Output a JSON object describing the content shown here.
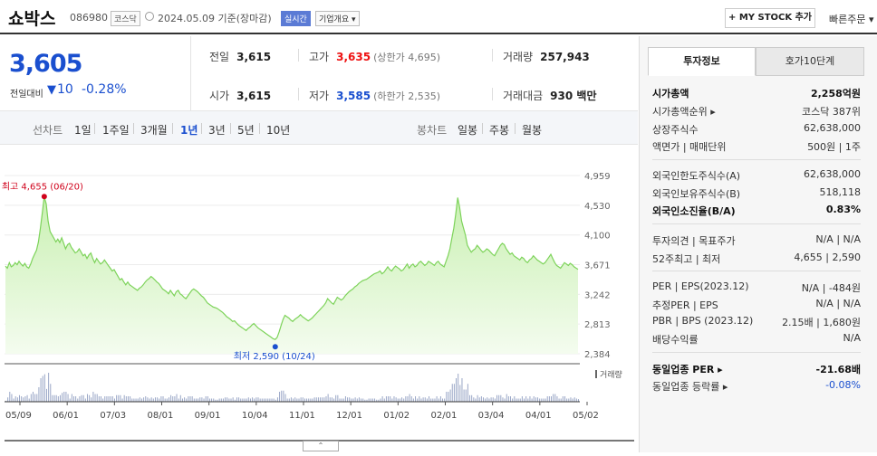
{
  "header": {
    "name": "쇼박스",
    "code": "086980",
    "market": "코스닥",
    "date_text": "2024.05.09 기준(장마감)",
    "realtime_badge": "실시간",
    "company_badge": "기업개요 ▾",
    "mystock_button": "+ MY STOCK 추가",
    "quick_order": "빠른주문 ▾"
  },
  "price": {
    "current": "3,605",
    "compare_label": "전일대비",
    "arrow": "▼",
    "change": "10",
    "change_pct": "-0.28%"
  },
  "stats": {
    "prev_label": "전일",
    "prev": "3,615",
    "high_label": "고가",
    "high": "3,635",
    "upper_limit": "(상한가 4,695)",
    "volume_label": "거래량",
    "volume": "257,943",
    "open_label": "시가",
    "open": "3,615",
    "low_label": "저가",
    "low": "3,585",
    "lower_limit": "(하한가 2,535)",
    "amount_label": "거래대금",
    "amount": "930 백만"
  },
  "periods": {
    "line_label": "선차트",
    "items": [
      "1일",
      "1주일",
      "3개월",
      "1년",
      "3년",
      "5년",
      "10년"
    ],
    "active": "1년",
    "candle_label": "봉차트",
    "candle_items": [
      "일봉",
      "주봉",
      "월봉"
    ]
  },
  "chart_data": {
    "type": "area",
    "x_ticks": [
      "05/09",
      "06/01",
      "07/03",
      "08/01",
      "09/01",
      "10/04",
      "11/01",
      "12/01",
      "01/02",
      "02/01",
      "03/04",
      "04/01",
      "05/02"
    ],
    "y_ticks": [
      "4,959",
      "4,530",
      "4,100",
      "3,671",
      "3,242",
      "2,813",
      "2,384"
    ],
    "ylim": [
      2384,
      4959
    ],
    "high_label": "최고 4,655 (06/20)",
    "low_label": "최저 2,590 (10/24)",
    "volume_label": "거래량",
    "colors": {
      "line": "#7dd35a",
      "fill_top": "#c9f0b2",
      "fill_bottom": "#f4fcef",
      "high": "#d0021b",
      "low": "#1a4fcf"
    },
    "values": [
      3650,
      3620,
      3700,
      3640,
      3660,
      3700,
      3670,
      3720,
      3680,
      3650,
      3690,
      3640,
      3620,
      3680,
      3760,
      3820,
      3880,
      4000,
      4200,
      4420,
      4655,
      4550,
      4300,
      4150,
      4100,
      4050,
      4000,
      4040,
      3990,
      4060,
      3980,
      3900,
      3960,
      3980,
      3920,
      3880,
      3840,
      3860,
      3900,
      3850,
      3800,
      3820,
      3760,
      3810,
      3840,
      3760,
      3700,
      3760,
      3720,
      3680,
      3700,
      3740,
      3700,
      3660,
      3620,
      3580,
      3600,
      3550,
      3500,
      3450,
      3470,
      3420,
      3380,
      3420,
      3380,
      3360,
      3340,
      3320,
      3300,
      3330,
      3350,
      3380,
      3420,
      3450,
      3470,
      3500,
      3480,
      3450,
      3420,
      3400,
      3360,
      3320,
      3300,
      3280,
      3250,
      3300,
      3260,
      3220,
      3280,
      3300,
      3250,
      3230,
      3200,
      3180,
      3220,
      3260,
      3300,
      3320,
      3300,
      3280,
      3250,
      3220,
      3200,
      3160,
      3120,
      3100,
      3080,
      3060,
      3050,
      3040,
      3020,
      3000,
      2980,
      2950,
      2920,
      2900,
      2880,
      2850,
      2860,
      2830,
      2800,
      2780,
      2760,
      2740,
      2720,
      2750,
      2770,
      2800,
      2820,
      2790,
      2760,
      2740,
      2720,
      2700,
      2680,
      2660,
      2640,
      2620,
      2600,
      2590,
      2620,
      2700,
      2790,
      2880,
      2940,
      2920,
      2900,
      2870,
      2850,
      2880,
      2900,
      2920,
      2950,
      2920,
      2900,
      2880,
      2860,
      2880,
      2900,
      2930,
      2960,
      2990,
      3020,
      3050,
      3080,
      3120,
      3180,
      3150,
      3120,
      3100,
      3150,
      3200,
      3180,
      3160,
      3180,
      3220,
      3250,
      3280,
      3300,
      3320,
      3350,
      3370,
      3400,
      3420,
      3440,
      3450,
      3460,
      3480,
      3500,
      3520,
      3540,
      3550,
      3560,
      3580,
      3540,
      3560,
      3600,
      3640,
      3600,
      3580,
      3620,
      3650,
      3630,
      3610,
      3580,
      3600,
      3640,
      3680,
      3620,
      3660,
      3680,
      3640,
      3660,
      3700,
      3720,
      3690,
      3660,
      3680,
      3720,
      3700,
      3680,
      3660,
      3700,
      3720,
      3680,
      3660,
      3640,
      3720,
      3800,
      3900,
      4050,
      4200,
      4400,
      4640,
      4500,
      4300,
      4200,
      4100,
      3950,
      3900,
      3850,
      3880,
      3900,
      3950,
      3920,
      3880,
      3850,
      3870,
      3900,
      3880,
      3850,
      3820,
      3800,
      3850,
      3900,
      3950,
      3980,
      3960,
      3900,
      3860,
      3820,
      3840,
      3800,
      3780,
      3760,
      3740,
      3780,
      3760,
      3720,
      3700,
      3740,
      3760,
      3800,
      3770,
      3740,
      3720,
      3700,
      3680,
      3700,
      3740,
      3780,
      3820,
      3760,
      3700,
      3660,
      3640,
      3620,
      3660,
      3700,
      3680,
      3660,
      3690,
      3670,
      3640,
      3620,
      3605
    ]
  },
  "panel": {
    "tab_active": "투자정보",
    "tab_other": "호가10단계",
    "rows": [
      {
        "k": "시가총액",
        "v": "2,258억원"
      },
      {
        "k": "시가총액순위 ▸",
        "v": "코스닥 387위"
      },
      {
        "k": "상장주식수",
        "v": "62,638,000"
      },
      {
        "k": "액면가 | 매매단위",
        "v": "500원 | 1주"
      },
      {
        "k": "외국인한도주식수(A)",
        "v": "62,638,000"
      },
      {
        "k": "외국인보유주식수(B)",
        "v": "518,118"
      },
      {
        "k": "외국인소진율(B/A)",
        "v": "0.83%"
      },
      {
        "k": "투자의견 | 목표주가",
        "v": "N/A | N/A"
      },
      {
        "k": "52주최고 | 최저",
        "v": "4,655 | 2,590"
      },
      {
        "k": "PER | EPS(2023.12)",
        "v": "N/A | -484원"
      },
      {
        "k": "추정PER | EPS",
        "v": "N/A | N/A"
      },
      {
        "k": "PBR | BPS (2023.12)",
        "v": "2.15배 | 1,680원"
      },
      {
        "k": "배당수익률",
        "v": "N/A"
      },
      {
        "k": "동일업종 PER ▸",
        "v": "-21.68배"
      },
      {
        "k": "동일업종 등락률 ▸",
        "v": "-0.08%"
      }
    ],
    "q": "?"
  },
  "toggle": "⌃"
}
